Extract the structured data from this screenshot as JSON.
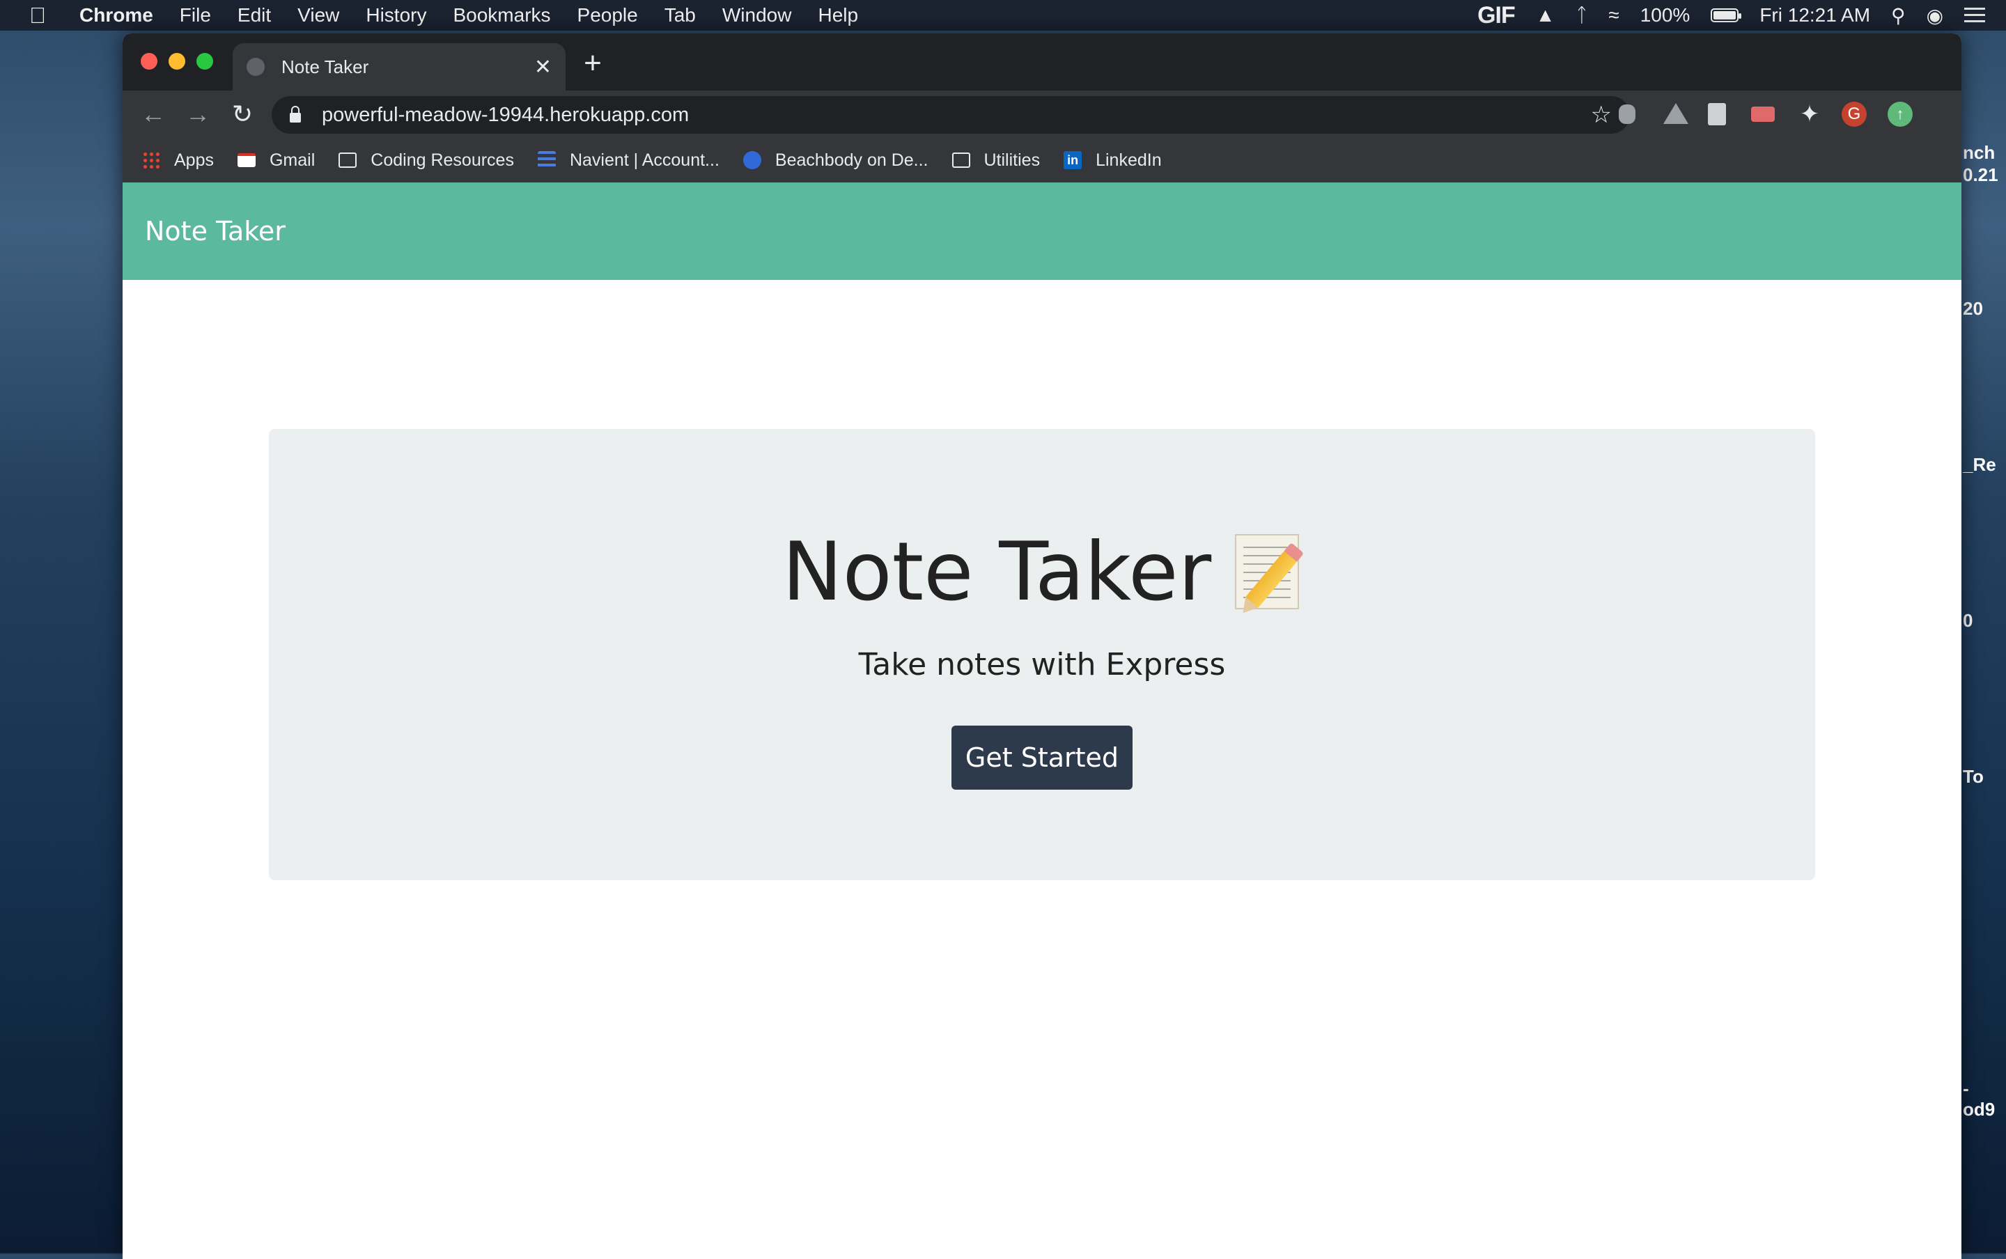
{
  "menubar": {
    "app_name": "Chrome",
    "items": [
      "File",
      "Edit",
      "View",
      "History",
      "Bookmarks",
      "People",
      "Tab",
      "Window",
      "Help"
    ],
    "status": {
      "gif": "GIF",
      "battery": "100%",
      "clock": "Fri 12:21 AM"
    }
  },
  "desktop_labels": [
    "nch",
    "0.21",
    "20",
    "_Re",
    "0",
    "To",
    "-",
    "od9"
  ],
  "browser": {
    "tab_title": "Note Taker",
    "url": "powerful-meadow-19944.herokuapp.com",
    "profile_initial": "G",
    "bookmarks": [
      {
        "label": "Apps",
        "icon": "apps-grid-icon"
      },
      {
        "label": "Gmail",
        "icon": "gmail-icon"
      },
      {
        "label": "Coding Resources",
        "icon": "folder-icon"
      },
      {
        "label": "Navient | Account...",
        "icon": "navient-icon"
      },
      {
        "label": "Beachbody on De...",
        "icon": "beachbody-icon"
      },
      {
        "label": "Utilities",
        "icon": "folder-icon"
      },
      {
        "label": "LinkedIn",
        "icon": "linkedin-icon"
      }
    ]
  },
  "page": {
    "navbar_brand": "Note Taker",
    "hero_title": "Note Taker",
    "hero_subtitle": "Take notes with Express",
    "cta_label": "Get Started",
    "colors": {
      "navbar": "#5bba9d",
      "button": "#2c3a4b",
      "jumbotron": "#ecefef"
    }
  }
}
